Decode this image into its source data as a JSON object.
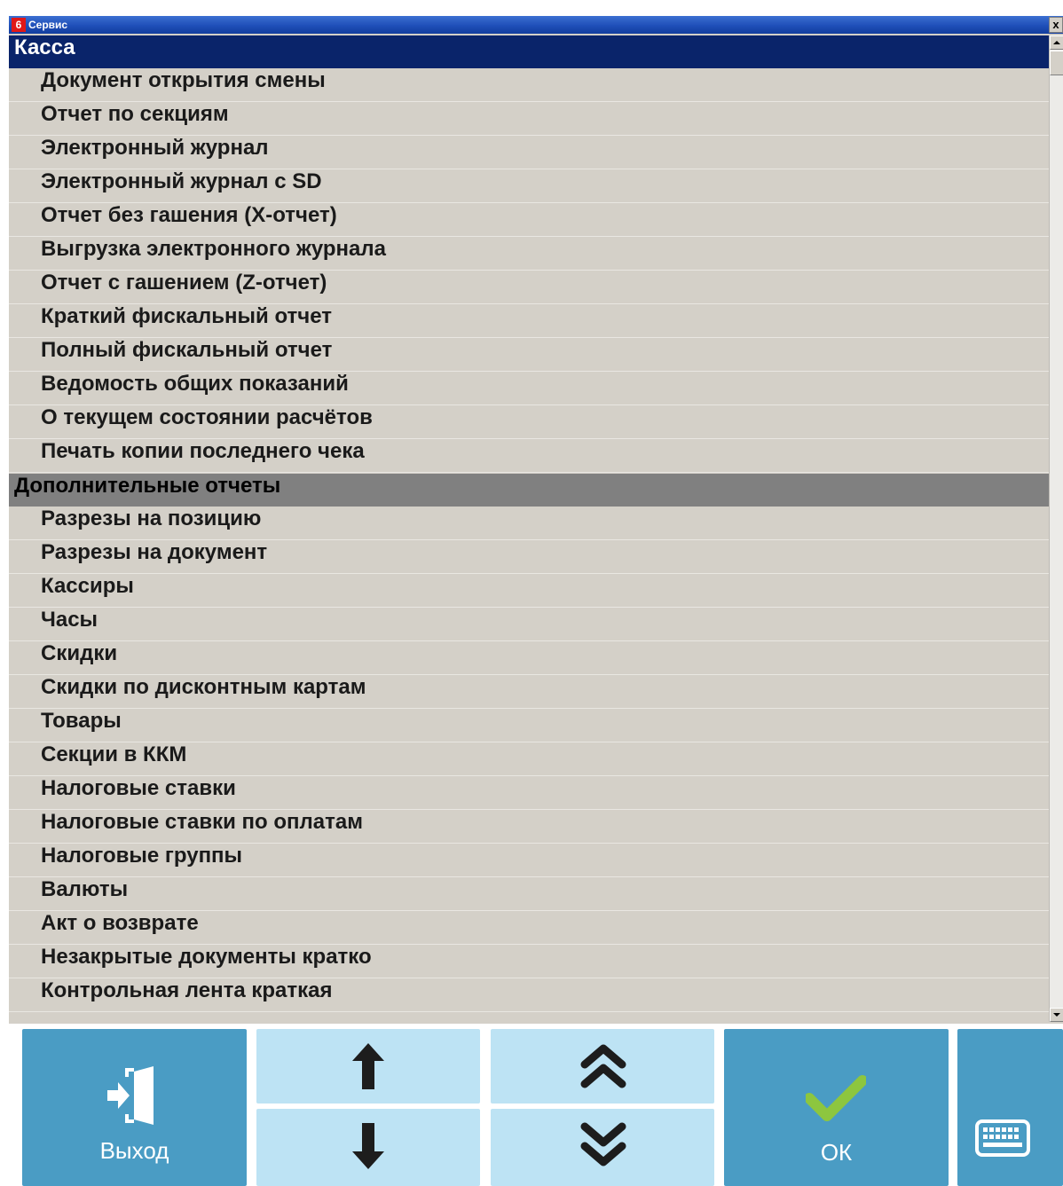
{
  "window": {
    "title": "Сервис",
    "icon_label": "6",
    "close_glyph": "x"
  },
  "list": {
    "sections": [
      {
        "header": "Касса",
        "selected": true,
        "items": [
          "Документ открытия смены",
          "Отчет по секциям",
          "Электронный журнал",
          "Электронный журнал с SD",
          "Отчет без гашения (X-отчет)",
          "Выгрузка электронного журнала",
          "Отчет с гашением (Z-отчет)",
          "Краткий фискальный отчет",
          "Полный фискальный отчет",
          "Ведомость общих показаний",
          "О текущем состоянии расчётов",
          "Печать копии последнего чека"
        ]
      },
      {
        "header": "Дополнительные отчеты",
        "selected": false,
        "items": [
          "Разрезы на позицию",
          "Разрезы на документ",
          "Кассиры",
          "Часы",
          "Скидки",
          "Скидки по дисконтным картам",
          "Товары",
          "Секции в ККМ",
          "Налоговые ставки",
          "Налоговые ставки по оплатам",
          "Налоговые группы",
          "Валюты",
          "Акт о возврате",
          "Незакрытые документы кратко",
          "Контрольная лента краткая"
        ]
      }
    ]
  },
  "toolbar": {
    "exit_label": "Выход",
    "ok_label": "ОК",
    "icons": {
      "exit": "exit-door-icon",
      "up": "arrow-up-icon",
      "down": "arrow-down-icon",
      "page_up": "double-chevron-up-icon",
      "page_down": "double-chevron-down-icon",
      "ok": "checkmark-icon",
      "keyboard": "keyboard-icon"
    }
  },
  "colors": {
    "selected_header_bg": "#0a246a",
    "section_header_bg": "#808080",
    "list_bg": "#d4d0c8",
    "button_dark": "#4a9cc4",
    "button_light": "#bde3f4",
    "checkmark": "#8dc63f"
  }
}
